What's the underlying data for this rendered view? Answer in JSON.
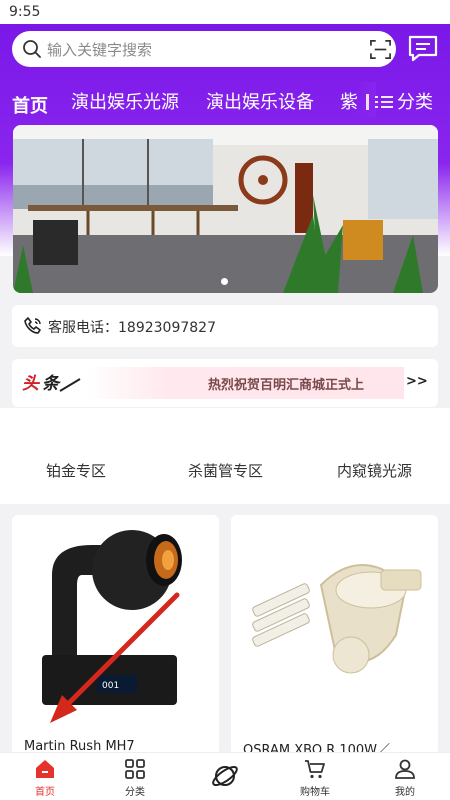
{
  "status_bar": {
    "time": "9:55"
  },
  "search": {
    "placeholder": "输入关键字搜索"
  },
  "tabs": [
    {
      "label": "首页",
      "active": true
    },
    {
      "label": "演出娱乐光源"
    },
    {
      "label": "演出娱乐设备"
    },
    {
      "label": "紫"
    }
  ],
  "category_button": {
    "label": "分类"
  },
  "service": {
    "text": "客服电话：18923097827"
  },
  "news": {
    "logo_text": "头条",
    "headline": "热烈祝贺百明汇商城正式上",
    "more": ">>"
  },
  "zones": [
    {
      "label": "铂金专区"
    },
    {
      "label": "杀菌管专区"
    },
    {
      "label": "内窥镜光源"
    }
  ],
  "products": [
    {
      "name": "Martin Rush MH7"
    },
    {
      "name": "OSRAM XBO R 100W／"
    }
  ],
  "bottom_nav": [
    {
      "label": "首页",
      "icon": "home-icon",
      "active": true
    },
    {
      "label": "分类",
      "icon": "grid-icon"
    },
    {
      "label": "",
      "icon": "planet-icon"
    },
    {
      "label": "购物车",
      "icon": "cart-icon"
    },
    {
      "label": "我的",
      "icon": "user-icon"
    }
  ],
  "colors": {
    "brand_purple": "#8a25ee",
    "active_red": "#e5322d"
  }
}
